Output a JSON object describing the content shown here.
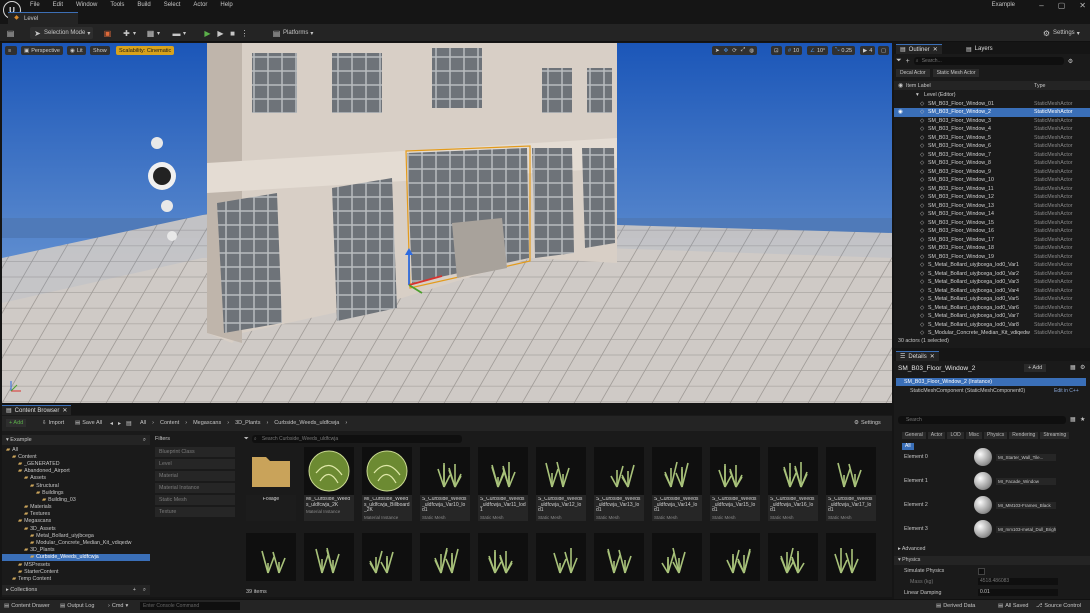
{
  "app": {
    "project_name": "Example",
    "logo_letter": "U"
  },
  "menu": [
    "File",
    "Edit",
    "Window",
    "Tools",
    "Build",
    "Select",
    "Actor",
    "Help"
  ],
  "level_tab": {
    "label": "Level"
  },
  "toolbar": {
    "selection_mode": "Selection Mode",
    "platforms": "Platforms",
    "settings": "Settings"
  },
  "viewport": {
    "perspective": "Perspective",
    "lit": "Lit",
    "show": "Show",
    "scalability": "Scalability: Cinematic",
    "grid_snap": "10",
    "rotation_snap": "10°",
    "scale_snap": "0.25",
    "camera_speed": "4"
  },
  "outliner": {
    "tab_outliner": "Outliner",
    "tab_layers": "Layers",
    "search_placeholder": "Search...",
    "chip_decal": "Decal Actor",
    "chip_static": "Static Mesh Actor",
    "col_label": "Item Label",
    "col_type": "Type",
    "level_item": "Level (Editor)",
    "rows": [
      {
        "name": "SM_B03_Floor_Window_01",
        "type": "StaticMeshActor"
      },
      {
        "name": "SM_B03_Floor_Window_2",
        "type": "StaticMeshActor"
      },
      {
        "name": "SM_B03_Floor_Window_3",
        "type": "StaticMeshActor"
      },
      {
        "name": "SM_B03_Floor_Window_4",
        "type": "StaticMeshActor"
      },
      {
        "name": "SM_B03_Floor_Window_5",
        "type": "StaticMeshActor"
      },
      {
        "name": "SM_B03_Floor_Window_6",
        "type": "StaticMeshActor"
      },
      {
        "name": "SM_B03_Floor_Window_7",
        "type": "StaticMeshActor"
      },
      {
        "name": "SM_B03_Floor_Window_8",
        "type": "StaticMeshActor"
      },
      {
        "name": "SM_B03_Floor_Window_9",
        "type": "StaticMeshActor"
      },
      {
        "name": "SM_B03_Floor_Window_10",
        "type": "StaticMeshActor"
      },
      {
        "name": "SM_B03_Floor_Window_11",
        "type": "StaticMeshActor"
      },
      {
        "name": "SM_B03_Floor_Window_12",
        "type": "StaticMeshActor"
      },
      {
        "name": "SM_B03_Floor_Window_13",
        "type": "StaticMeshActor"
      },
      {
        "name": "SM_B03_Floor_Window_14",
        "type": "StaticMeshActor"
      },
      {
        "name": "SM_B03_Floor_Window_15",
        "type": "StaticMeshActor"
      },
      {
        "name": "SM_B03_Floor_Window_16",
        "type": "StaticMeshActor"
      },
      {
        "name": "SM_B03_Floor_Window_17",
        "type": "StaticMeshActor"
      },
      {
        "name": "SM_B03_Floor_Window_18",
        "type": "StaticMeshActor"
      },
      {
        "name": "SM_B03_Floor_Window_19",
        "type": "StaticMeshActor"
      },
      {
        "name": "S_Metal_Bollard_uiyjbcega_lod0_Var1",
        "type": "StaticMeshActor"
      },
      {
        "name": "S_Metal_Bollard_uiyjbcega_lod0_Var2",
        "type": "StaticMeshActor"
      },
      {
        "name": "S_Metal_Bollard_uiyjbcega_lod0_Var3",
        "type": "StaticMeshActor"
      },
      {
        "name": "S_Metal_Bollard_uiyjbcega_lod0_Var4",
        "type": "StaticMeshActor"
      },
      {
        "name": "S_Metal_Bollard_uiyjbcega_lod0_Var5",
        "type": "StaticMeshActor"
      },
      {
        "name": "S_Metal_Bollard_uiyjbcega_lod0_Var6",
        "type": "StaticMeshActor"
      },
      {
        "name": "S_Metal_Bollard_uiyjbcega_lod0_Var7",
        "type": "StaticMeshActor"
      },
      {
        "name": "S_Metal_Bollard_uiyjbcega_lod0_Var8",
        "type": "StaticMeshActor"
      },
      {
        "name": "S_Modular_Concrete_Median_Kit_vdiqedw",
        "type": "StaticMeshActor"
      }
    ],
    "status": "30 actors (1 selected)"
  },
  "details": {
    "tab": "Details",
    "actor_name": "SM_B03_Floor_Window_2",
    "add_label": "+ Add",
    "instance_row": "SM_B03_Floor_Window_2 (Instance)",
    "component_row": "StaticMeshComponent (StaticMeshComponent0)",
    "edit_cpp": "Edit in C++",
    "search_placeholder": "Search",
    "tabs": [
      "General",
      "Actor",
      "LOD",
      "Misc",
      "Physics",
      "Rendering",
      "Streaming",
      "All"
    ],
    "elements": [
      {
        "label": "Element 0",
        "material": "MI_Starter_Wall_Tile..."
      },
      {
        "label": "Element 1",
        "material": "MI_Facade_Window"
      },
      {
        "label": "Element 2",
        "material": "MI_MM103-Frames_Black"
      },
      {
        "label": "Element 3",
        "material": "MI_mm103-metal_Dull_Bright"
      }
    ],
    "section_advanced": "Advanced",
    "section_physics": "Physics",
    "simulate_physics": "Simulate Physics",
    "mass_label": "Mass (kg)",
    "mass_value": "4518.486083",
    "linear_damping": "Linear Damping",
    "linear_damping_value": "0.01"
  },
  "content_browser": {
    "tab": "Content Browser",
    "add": "+ Add",
    "import": "Import",
    "save_all": "Save All",
    "breadcrumb": [
      "All",
      "Content",
      "Megascans",
      "3D_Plants",
      "Curbside_Weeds_uldfcwja"
    ],
    "settings": "Settings",
    "tree_header": "Example",
    "tree": [
      {
        "label": "All",
        "depth": 0
      },
      {
        "label": "Content",
        "depth": 1
      },
      {
        "label": "_GENERATED",
        "depth": 2
      },
      {
        "label": "Abandoned_Airport",
        "depth": 2
      },
      {
        "label": "Assets",
        "depth": 3
      },
      {
        "label": "Structural",
        "depth": 4
      },
      {
        "label": "Buildings",
        "depth": 5
      },
      {
        "label": "Building_03",
        "depth": 6
      },
      {
        "label": "Materials",
        "depth": 3
      },
      {
        "label": "Textures",
        "depth": 3
      },
      {
        "label": "Megascans",
        "depth": 2
      },
      {
        "label": "3D_Assets",
        "depth": 3
      },
      {
        "label": "Metal_Bollard_uiyjbcega",
        "depth": 4
      },
      {
        "label": "Modular_Concrete_Median_Kit_vdiqedw",
        "depth": 4
      },
      {
        "label": "3D_Plants",
        "depth": 3
      },
      {
        "label": "Curbside_Weeds_uldfcwja",
        "depth": 4
      },
      {
        "label": "MSPresets",
        "depth": 2
      },
      {
        "label": "StarterContent",
        "depth": 2
      },
      {
        "label": "Temp Content",
        "depth": 1
      }
    ],
    "collections": "Collections",
    "filters_title": "Filters",
    "filters": [
      "Blueprint Class",
      "Level",
      "Material",
      "Material Instance",
      "Static Mesh",
      "Texture"
    ],
    "search_placeholder": "Search Curbside_Weeds_uldfcwja",
    "items_row1": [
      {
        "name": "Foliage",
        "sub": ""
      },
      {
        "name": "MI_Curbside_Weeds_uldfcwja_2K",
        "sub": "Material Instance"
      },
      {
        "name": "MI_Curbside_Weeds_uldfcwja_Billboard_2K",
        "sub": "Material Instance"
      },
      {
        "name": "S_Curbside_Weeds_uldfcwja_Var10_lod1",
        "sub": "Static Mesh"
      },
      {
        "name": "S_Curbside_Weeds_uldfcwja_Var11_lod1",
        "sub": "Static Mesh"
      },
      {
        "name": "S_Curbside_Weeds_uldfcwja_Var12_lod1",
        "sub": "Static Mesh"
      },
      {
        "name": "S_Curbside_Weeds_uldfcwja_Var13_lod1",
        "sub": "Static Mesh"
      },
      {
        "name": "S_Curbside_Weeds_uldfcwja_Var14_lod1",
        "sub": "Static Mesh"
      },
      {
        "name": "S_Curbside_Weeds_uldfcwja_Var15_lod1",
        "sub": "Static Mesh"
      },
      {
        "name": "S_Curbside_Weeds_uldfcwja_Var16_lod1",
        "sub": "Static Mesh"
      },
      {
        "name": "S_Curbside_Weeds_uldfcwja_Var17_lod1",
        "sub": "Static Mesh"
      }
    ],
    "item_count": "39 items"
  },
  "statusbar": {
    "content_drawer": "Content Drawer",
    "output_log": "Output Log",
    "cmd": "Cmd",
    "console_placeholder": "Enter Console Command",
    "derived_data": "Derived Data",
    "all_saved": "All Saved",
    "source_control": "Source Control"
  },
  "colors": {
    "accent": "#3a6fb8",
    "play": "#5bb04a",
    "scalability_badge": "#d8a21c",
    "panel": "#1a1a1a"
  }
}
